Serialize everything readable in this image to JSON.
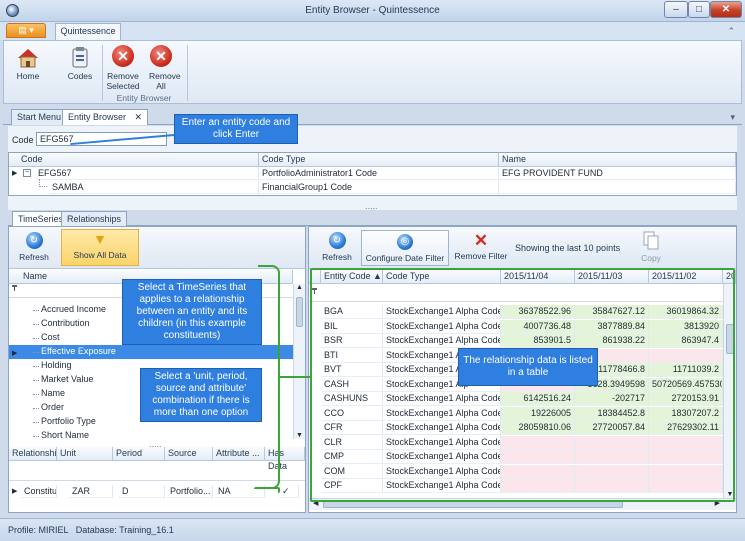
{
  "window": {
    "title": "Entity Browser - Quintessence"
  },
  "ribbon": {
    "tab": "Quintessence",
    "buttons": {
      "home": "Home",
      "codes": "Codes",
      "remove_selected": "Remove Selected",
      "remove_all": "Remove All"
    },
    "group_label": "Entity Browser"
  },
  "doc_tabs": {
    "start_menu": "Start Menu",
    "entity_browser": "Entity Browser",
    "close": "✕"
  },
  "code": {
    "label": "Code",
    "value": "EFG567"
  },
  "entity_grid": {
    "headers": [
      "Code",
      "Code Type",
      "Name"
    ],
    "rows": [
      {
        "code": "EFG567",
        "type": "PortfolioAdministrator1 Code",
        "name": "EFG PROVIDENT FUND"
      },
      {
        "code": "SAMBA",
        "type": "FinancialGroup1 Code",
        "name": ""
      }
    ]
  },
  "inner_tabs": {
    "timeseries": "TimeSeries",
    "relationships": "Relationships"
  },
  "left_toolbar": {
    "refresh": "Refresh",
    "show_all": "Show All Data"
  },
  "ts_list": {
    "header": "Name",
    "items": [
      "Accrued Income",
      "Contribution",
      "Cost",
      "Effective Exposure",
      "Holding",
      "Market Value",
      "Name",
      "Order",
      "Portfolio Type",
      "Short Name"
    ],
    "selected": "Effective Exposure"
  },
  "rel_grid": {
    "headers": [
      "Relationship",
      "Unit",
      "Period",
      "Source",
      "Attribute ...",
      "Has Data"
    ],
    "row": {
      "relationship": "Constituent",
      "unit": "ZAR",
      "period": "D",
      "source": "Portfolio...",
      "attribute": "NA",
      "has_data": "✓"
    }
  },
  "right_toolbar": {
    "refresh": "Refresh",
    "configure": "Configure Date Filter",
    "remove_filter": "Remove Filter",
    "showing": "Showing the last 10 points",
    "copy": "Copy"
  },
  "data_grid": {
    "headers": [
      "Entity Code",
      "Code Type",
      "2015/11/04",
      "2015/11/03",
      "2015/11/02",
      "20"
    ],
    "rows": [
      {
        "code": "BGA",
        "type": "StockExchange1 Alpha Code",
        "v1": "36378522.96",
        "v2": "35847627.12",
        "v3": "36019864.32"
      },
      {
        "code": "BIL",
        "type": "StockExchange1 Alpha Code",
        "v1": "4007736.48",
        "v2": "3877889.84",
        "v3": "3813920"
      },
      {
        "code": "BSR",
        "type": "StockExchange1 Alpha Code",
        "v1": "853901.5",
        "v2": "861938.22",
        "v3": "863947.4"
      },
      {
        "code": "BTI",
        "type": "StockExchange1 Alp",
        "v1": "",
        "v2": "",
        "v3": ""
      },
      {
        "code": "BVT",
        "type": "StockExchange1 Alp",
        "v1": "",
        "v2": "11778466.8",
        "v3": "11711039.2"
      },
      {
        "code": "CASH",
        "type": "StockExchange1 Alp",
        "v1": "",
        "v2": "3628.3949598",
        "v3": "50720569.4575304"
      },
      {
        "code": "CASHUNS",
        "type": "StockExchange1 Alpha Code",
        "v1": "6142516.24",
        "v2": "-202717",
        "v3": "2720153.91"
      },
      {
        "code": "CCO",
        "type": "StockExchange1 Alpha Code",
        "v1": "19226005",
        "v2": "18384452.8",
        "v3": "18307207.2"
      },
      {
        "code": "CFR",
        "type": "StockExchange1 Alpha Code",
        "v1": "28059810.06",
        "v2": "27720057.84",
        "v3": "27629302.11"
      },
      {
        "code": "CLR",
        "type": "StockExchange1 Alpha Code",
        "v1": "",
        "v2": "",
        "v3": ""
      },
      {
        "code": "CMP",
        "type": "StockExchange1 Alpha Code",
        "v1": "",
        "v2": "",
        "v3": ""
      },
      {
        "code": "COM",
        "type": "StockExchange1 Alpha Code",
        "v1": "",
        "v2": "",
        "v3": ""
      },
      {
        "code": "CPF",
        "type": "StockExchange1 Alpha Code",
        "v1": "",
        "v2": "",
        "v3": ""
      }
    ]
  },
  "callouts": {
    "entity": "Enter an entity code and click Enter",
    "timeseries": "Select a TimeSeries that applies to a relationship between an entity and its children (in this example constituents)",
    "unit": "Select a 'unit, period, source and attribute' combination if there is more than one option",
    "relationship": "The relationship data is listed in a table"
  },
  "status": {
    "profile_label": "Profile:",
    "profile": "MIRIEL",
    "db_label": "Database:",
    "db": "Training_16.1"
  },
  "splitter": "....."
}
